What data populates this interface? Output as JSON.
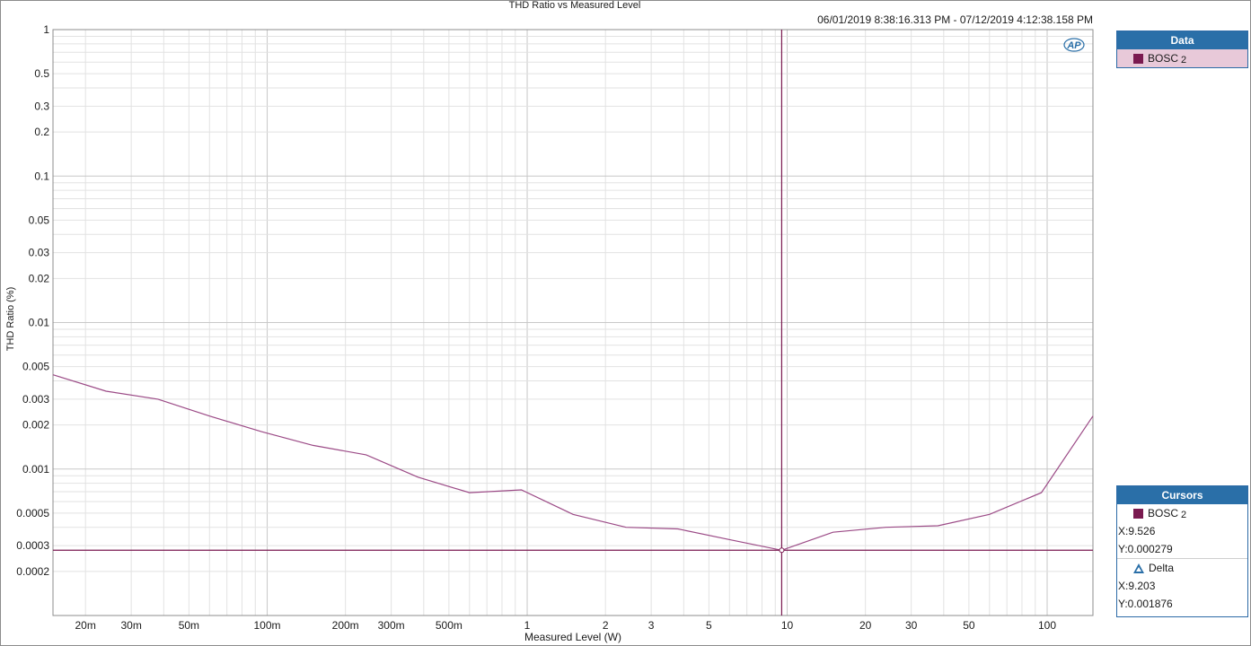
{
  "chart_data": {
    "type": "line",
    "title": "THD Ratio vs Measured Level",
    "subtitle": "06/01/2019 8:38:16.313 PM - 07/12/2019 4:12:38.158 PM",
    "xlabel": "Measured Level (W)",
    "ylabel": "THD Ratio (%)",
    "x_scale": "log",
    "y_scale": "log",
    "xlim": [
      0.015,
      150
    ],
    "ylim": [
      0.0001,
      1
    ],
    "grid": true,
    "x_ticks": [
      {
        "value": 0.02,
        "label": "20m"
      },
      {
        "value": 0.03,
        "label": "30m"
      },
      {
        "value": 0.05,
        "label": "50m"
      },
      {
        "value": 0.1,
        "label": "100m"
      },
      {
        "value": 0.2,
        "label": "200m"
      },
      {
        "value": 0.3,
        "label": "300m"
      },
      {
        "value": 0.5,
        "label": "500m"
      },
      {
        "value": 1,
        "label": "1"
      },
      {
        "value": 2,
        "label": "2"
      },
      {
        "value": 3,
        "label": "3"
      },
      {
        "value": 5,
        "label": "5"
      },
      {
        "value": 10,
        "label": "10"
      },
      {
        "value": 20,
        "label": "20"
      },
      {
        "value": 30,
        "label": "30"
      },
      {
        "value": 50,
        "label": "50"
      },
      {
        "value": 100,
        "label": "100"
      }
    ],
    "y_ticks": [
      {
        "value": 1,
        "label": "1"
      },
      {
        "value": 0.5,
        "label": "0.5"
      },
      {
        "value": 0.3,
        "label": "0.3"
      },
      {
        "value": 0.2,
        "label": "0.2"
      },
      {
        "value": 0.1,
        "label": "0.1"
      },
      {
        "value": 0.05,
        "label": "0.05"
      },
      {
        "value": 0.03,
        "label": "0.03"
      },
      {
        "value": 0.02,
        "label": "0.02"
      },
      {
        "value": 0.01,
        "label": "0.01"
      },
      {
        "value": 0.005,
        "label": "0.005"
      },
      {
        "value": 0.003,
        "label": "0.003"
      },
      {
        "value": 0.002,
        "label": "0.002"
      },
      {
        "value": 0.001,
        "label": "0.001"
      },
      {
        "value": 0.0005,
        "label": "0.0005"
      },
      {
        "value": 0.0003,
        "label": "0.0003"
      },
      {
        "value": 0.0002,
        "label": "0.0002"
      }
    ],
    "series": [
      {
        "name": "BOSC 2",
        "color": "#9b4a86",
        "x": [
          0.015,
          0.024,
          0.038,
          0.06,
          0.095,
          0.15,
          0.24,
          0.38,
          0.6,
          0.95,
          1.5,
          2.4,
          3.8,
          6.0,
          9.526,
          15,
          24,
          38,
          60,
          95,
          150
        ],
        "y": [
          0.0044,
          0.0034,
          0.003,
          0.0023,
          0.0018,
          0.00145,
          0.00125,
          0.00088,
          0.00069,
          0.00072,
          0.00049,
          0.0004,
          0.00039,
          0.00033,
          0.000279,
          0.00037,
          0.0004,
          0.00041,
          0.00049,
          0.00069,
          0.0023
        ]
      }
    ],
    "cursor": {
      "x": 9.526,
      "y": 0.000279
    },
    "logo_text": "AP",
    "legend_position": "right"
  },
  "legend_panel": {
    "header": "Data",
    "items": [
      {
        "name": "BOSC",
        "channel": "2",
        "color": "#7a1a50"
      }
    ]
  },
  "cursors_panel": {
    "header": "Cursors",
    "trace_name": "BOSC",
    "trace_channel": "2",
    "x_readout": "X:9.526",
    "y_readout": "Y:0.000279",
    "delta_label": "Delta",
    "delta_x": "X:9.203",
    "delta_y": "Y:0.001876"
  }
}
